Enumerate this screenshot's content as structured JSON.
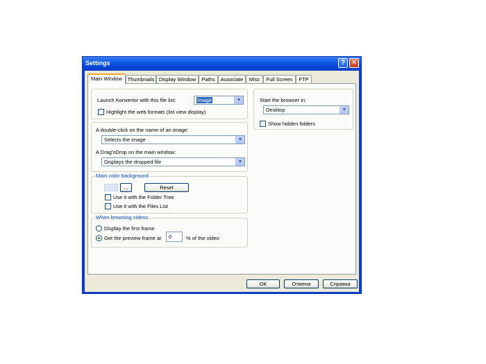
{
  "window": {
    "title": "Settings",
    "help_icon": "?",
    "close_icon": "✕"
  },
  "tabs": [
    "Main Window",
    "Thumbnails",
    "Display Window",
    "Paths",
    "Associate",
    "Misc",
    "Full Screen",
    "FTP"
  ],
  "launch": {
    "label": "Launch Konvertor with this file list:",
    "value": "Image"
  },
  "highlight": {
    "label": "Highlight the web formats (list view display)",
    "checked": false
  },
  "double_click": {
    "label": "A double-click on the name of an image:",
    "value": "Selects the image"
  },
  "drag_drop": {
    "label": "A Drag'nDrop on the main window:",
    "value": "Displays the dropped file"
  },
  "color_bg": {
    "legend": "Main color background",
    "browse_label": "...",
    "reset_label": "Reset",
    "swatch_color": "#dce6f4",
    "folder_tree_label": "Use it with the Folder Tree",
    "files_list_label": "Use it with the Files List"
  },
  "videos": {
    "legend": "When browsing videos",
    "first_frame_label": "Display the first frame",
    "preview_label": "Get the preview frame at",
    "preview_value": "0",
    "suffix": "% of the video"
  },
  "browser": {
    "label": "Start the browser in:",
    "value": "Desktop",
    "hidden_label": "Show hidden folders"
  },
  "buttons": {
    "ok": "OK",
    "cancel": "Отмена",
    "help": "Справка"
  },
  "icons": {
    "dropdown": "▼"
  },
  "colors": {
    "titlebar": "#0a55e0",
    "accent_tab": "#f0a92e",
    "legend": "#0046d5"
  }
}
